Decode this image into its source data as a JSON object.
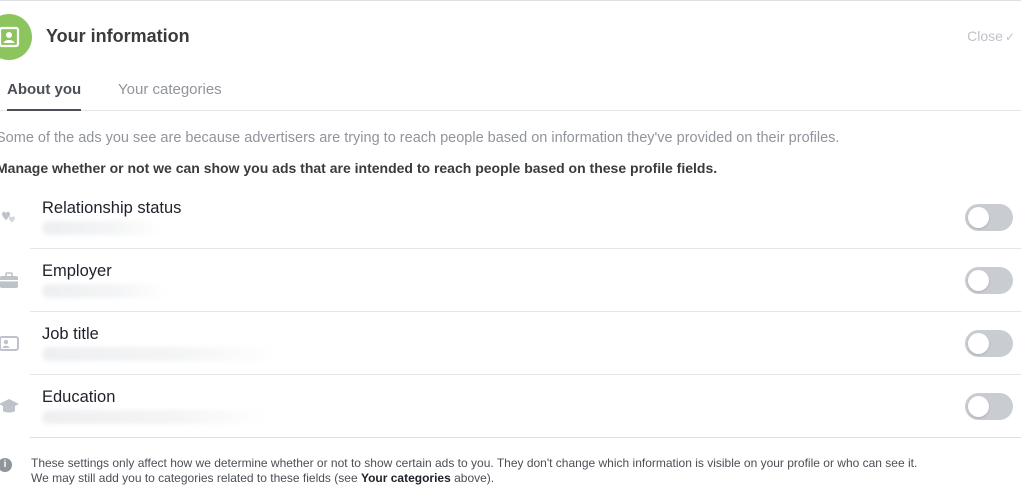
{
  "header": {
    "icon": "profile-card-icon",
    "title": "Your information",
    "close_label": "Close"
  },
  "tabs": [
    {
      "label": "About you",
      "active": true
    },
    {
      "label": "Your categories",
      "active": false
    }
  ],
  "intro_text": "Some of the ads you see are because advertisers are trying to reach people based on information they've provided on their profiles.",
  "manage_text": "Manage whether or not we can show you ads that are intended to reach people based on these profile fields.",
  "fields": [
    {
      "label": "Relationship status",
      "icon": "relationship-icon",
      "enabled": false
    },
    {
      "label": "Employer",
      "icon": "briefcase-icon",
      "enabled": false
    },
    {
      "label": "Job title",
      "icon": "id-badge-icon",
      "enabled": false
    },
    {
      "label": "Education",
      "icon": "graduation-cap-icon",
      "enabled": false
    }
  ],
  "footer": {
    "icon": "info-icon",
    "line1": "These settings only affect how we determine whether or not to show certain ads to you. They don't change which information is visible on your profile or who can see it.",
    "line2_prefix": "We may still add you to categories related to these fields (see ",
    "line2_link": "Your categories",
    "line2_suffix": " above)."
  },
  "colors": {
    "accent_green": "#8cc55e",
    "toggle_off": "#c9ccd1",
    "muted_text": "#90949c"
  }
}
